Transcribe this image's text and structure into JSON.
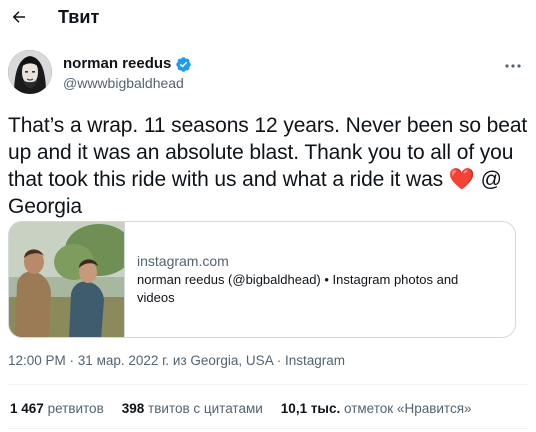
{
  "header": {
    "title": "Твит",
    "back_icon": "arrow-left-icon"
  },
  "author": {
    "name": "norman reedus",
    "handle": "@wwwbigbaldhead",
    "verified_color": "#1d9bf0"
  },
  "tweet": {
    "text_before_heart": "That’s a wrap. 11 seasons 12 years. Never been so beat up and it was an absolute blast. Thank you to all of you that took this ride with us and what a ride it was ",
    "heart": "❤️",
    "text_after_heart": " @ Georgia"
  },
  "card": {
    "domain": "instagram.com",
    "description": "norman reedus (@bigbaldhead) • Instagram photos and videos"
  },
  "meta": {
    "time": "12:00 PM",
    "date": "31 мар. 2022 г. из Georgia, USA",
    "source": "Instagram",
    "sep": " · "
  },
  "stats": {
    "retweets_count": "1 467",
    "retweets_label": "ретвитов",
    "quotes_count": "398",
    "quotes_label": "твитов с цитатами",
    "likes_count": "10,1 тыс.",
    "likes_label": "отметок «Нравится»"
  }
}
